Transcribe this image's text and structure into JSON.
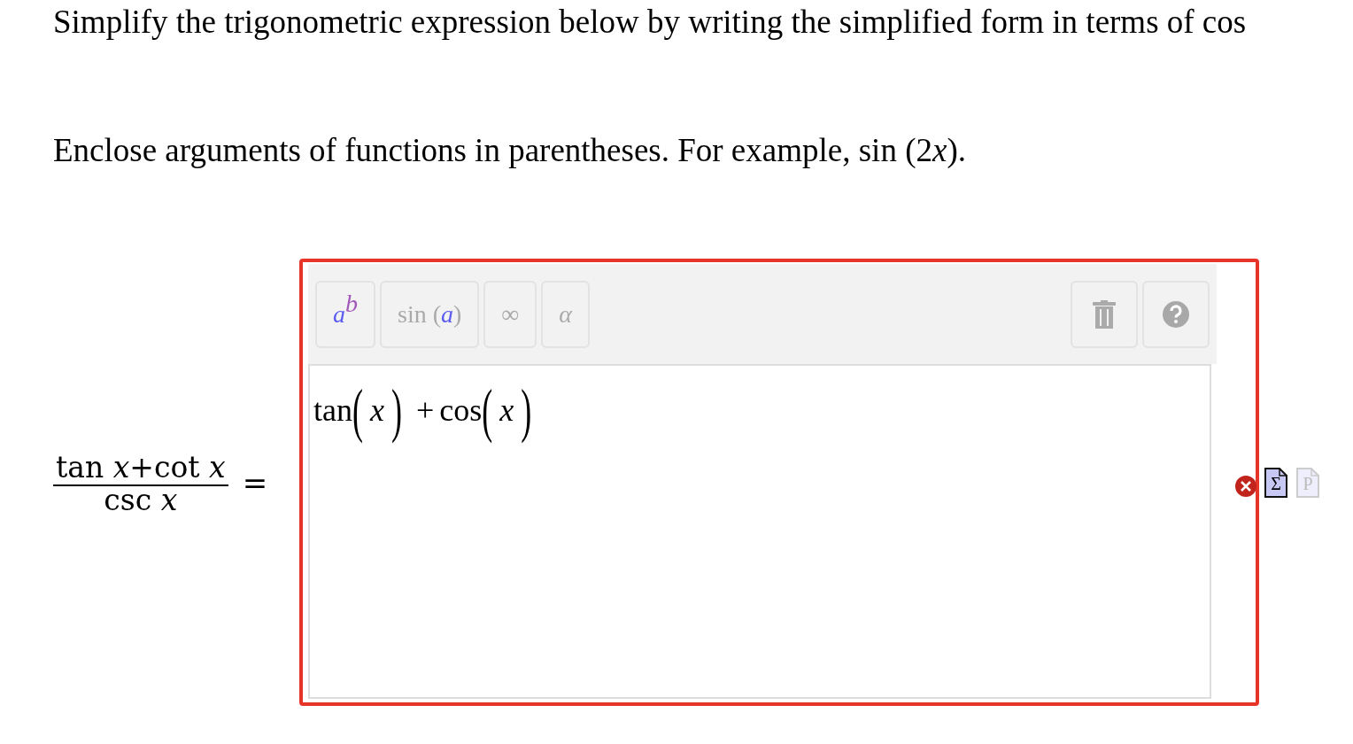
{
  "instructions": [
    "Simplify the trigonometric expression below by writing the simplified form in terms of cos",
    {
      "before": "Enclose arguments of functions in parentheses. For example, sin (2",
      "italic": "x",
      "after": ")."
    }
  ],
  "expression": {
    "numerator": "tan *x*+cot *x*",
    "denominator": "csc *x*",
    "equals": "="
  },
  "editor": {
    "error": true,
    "toolbar": [
      {
        "kind": "power",
        "base": "a",
        "exponent": "b"
      },
      {
        "kind": "function",
        "name": "sin",
        "open": "(",
        "arg": "a",
        "close": ")"
      },
      {
        "kind": "symbol",
        "text": "∞"
      },
      {
        "kind": "greek",
        "text": "α"
      }
    ],
    "answer": [
      {
        "kind": "func",
        "text": "tan"
      },
      {
        "kind": "paren",
        "text": "("
      },
      {
        "kind": "var",
        "text": "x"
      },
      {
        "kind": "paren",
        "text": ")"
      },
      {
        "kind": "op",
        "text": "+"
      },
      {
        "kind": "func",
        "text": "cos"
      },
      {
        "kind": "paren",
        "text": "("
      },
      {
        "kind": "var",
        "text": "x"
      },
      {
        "kind": "paren",
        "text": ")"
      }
    ]
  },
  "format_buttons": [
    {
      "glyph": "Σ",
      "disabled": false
    },
    {
      "glyph": "P",
      "disabled": true
    }
  ]
}
